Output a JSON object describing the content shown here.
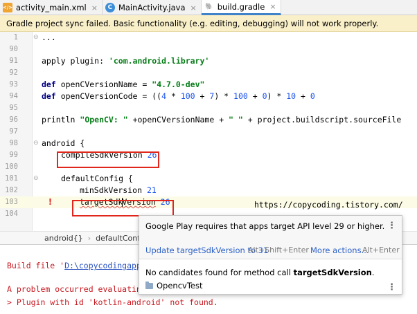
{
  "tabs": [
    {
      "label": "activity_main.xml",
      "icon": "xml-file-icon"
    },
    {
      "label": "MainActivity.java",
      "icon": "java-class-icon"
    },
    {
      "label": "build.gradle",
      "icon": "gradle-file-icon"
    }
  ],
  "tab_icon_glyphs": {
    "xml": "</>",
    "java": "C",
    "gradle": "🐘",
    "close": "×"
  },
  "banner": {
    "text": "Gradle project sync failed. Basic functionality (e.g. editing, debugging) will not work properly."
  },
  "editor": {
    "lines": [
      {
        "num": "1",
        "text": "..."
      },
      {
        "num": "90",
        "text": ""
      },
      {
        "num": "91",
        "kw": "apply plugin: ",
        "str": "'com.android.library'"
      },
      {
        "num": "92",
        "text": ""
      },
      {
        "num": "93",
        "kw": "def ",
        "text": "openCVersionName = ",
        "str": "\"4.7.0-dev\""
      },
      {
        "num": "94",
        "kw": "def ",
        "text": "openCVersionCode = ((",
        "n1": "4",
        "t1": " * ",
        "n2": "100",
        "t2": " + ",
        "n3": "7",
        "t3": ") * ",
        "n4": "100",
        "t4": " + ",
        "n5": "0",
        "t5": ") * ",
        "n6": "10",
        "t6": " + ",
        "n7": "0"
      },
      {
        "num": "95",
        "text": ""
      },
      {
        "num": "96",
        "text": "println ",
        "str": "\"OpenCV: \"",
        "text2": " +openCVersionName + ",
        "str2": "\" \"",
        "text3": " + project.buildscript.sourceFile"
      },
      {
        "num": "97",
        "text": ""
      },
      {
        "num": "98",
        "text": "android {"
      },
      {
        "num": "99",
        "text": "compileSdkVersion ",
        "n1": "26"
      },
      {
        "num": "100",
        "text": ""
      },
      {
        "num": "101",
        "text": "defaultConfig {"
      },
      {
        "num": "102",
        "text": "minSdkVersion ",
        "n1": "21"
      },
      {
        "num": "103",
        "squig_a": "targetSdk",
        "squig_b": "Version",
        "n1": "26"
      },
      {
        "num": "104",
        "text": ""
      }
    ],
    "fold_glyph": "⊖",
    "error_glyph": "!"
  },
  "watermark": "https://copycoding.tistory.com/",
  "breadcrumb": {
    "items": [
      "android{}",
      "defaultConfig{}"
    ],
    "separator": "›"
  },
  "build_output": {
    "line1_prefix": "Build file '",
    "line1_link": "D:\\copycodingapp",
    "line2": "A problem occurred evaluatin",
    "line3": "> Plugin with id 'kotlin-android' not found."
  },
  "popup": {
    "message": "Google Play requires that apps target API level 29 or higher.",
    "fix_link": "Update targetSdkVersion to 31",
    "fix_shortcut": "Alt+Shift+Enter",
    "more_link": "More actions...",
    "more_shortcut": "Alt+Enter",
    "error_prefix": "No candidates found for method call ",
    "error_method": "targetSdkVersion",
    "error_suffix": ".",
    "module": "OpencvTest",
    "menu_glyph": "⋮"
  }
}
